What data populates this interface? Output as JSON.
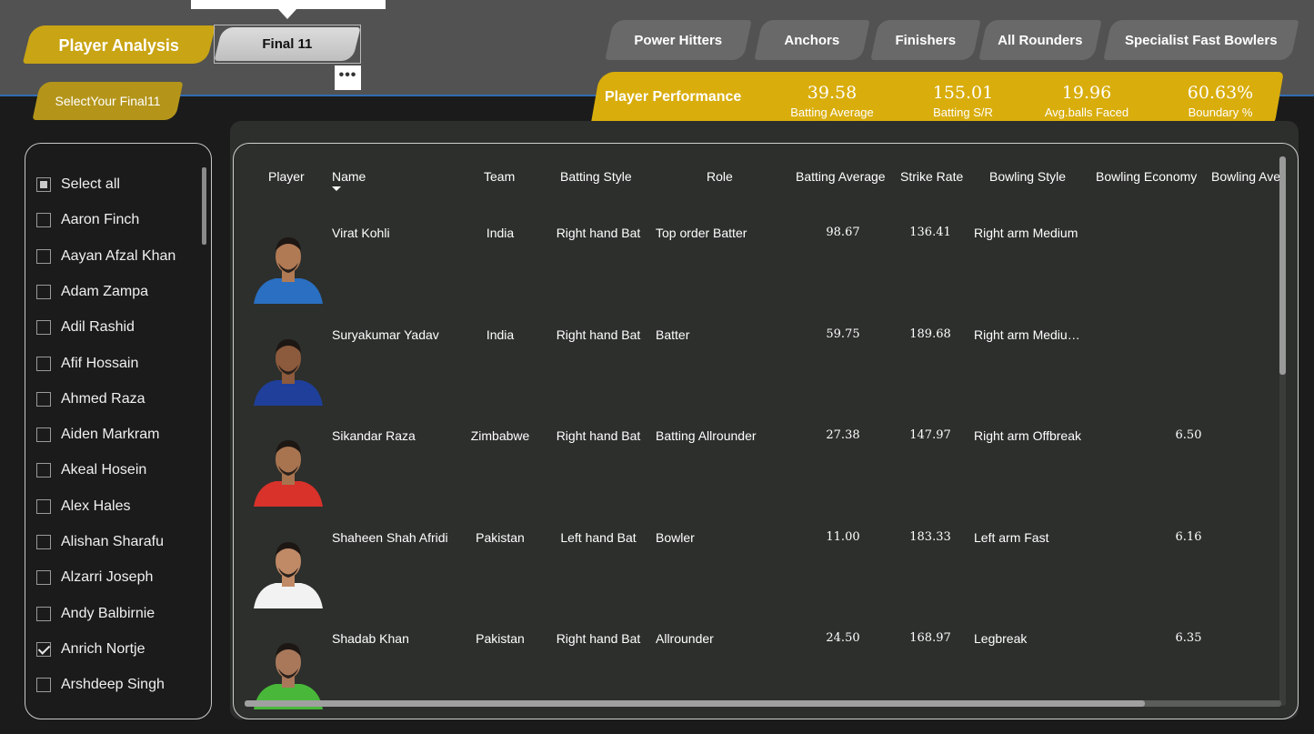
{
  "header": {
    "tabs": {
      "player_analysis": "Player Analysis",
      "final11": "Final 11",
      "more": "•••"
    },
    "select_final11": "SelectYour Final11",
    "nav": [
      "Power Hitters",
      "Anchors",
      "Finishers",
      "All Rounders",
      "Specialist Fast Bowlers"
    ]
  },
  "kpi": {
    "title": "Player Performance",
    "items": [
      {
        "value": "39.58",
        "label": "Batting Average"
      },
      {
        "value": "155.01",
        "label": "Batting S/R"
      },
      {
        "value": "19.96",
        "label": "Avg.balls Faced"
      },
      {
        "value": "60.63%",
        "label": "Boundary %"
      }
    ]
  },
  "slicer": {
    "items": [
      {
        "label": "Select all",
        "state": "partial"
      },
      {
        "label": "Aaron Finch",
        "state": "unchecked"
      },
      {
        "label": "Aayan Afzal Khan",
        "state": "unchecked"
      },
      {
        "label": "Adam Zampa",
        "state": "unchecked"
      },
      {
        "label": "Adil Rashid",
        "state": "unchecked"
      },
      {
        "label": "Afif Hossain",
        "state": "unchecked"
      },
      {
        "label": "Ahmed Raza",
        "state": "unchecked"
      },
      {
        "label": "Aiden Markram",
        "state": "unchecked"
      },
      {
        "label": "Akeal Hosein",
        "state": "unchecked"
      },
      {
        "label": "Alex Hales",
        "state": "unchecked"
      },
      {
        "label": "Alishan Sharafu",
        "state": "unchecked"
      },
      {
        "label": "Alzarri Joseph",
        "state": "unchecked"
      },
      {
        "label": "Andy Balbirnie",
        "state": "unchecked"
      },
      {
        "label": "Anrich Nortje",
        "state": "checked"
      },
      {
        "label": "Arshdeep Singh",
        "state": "unchecked"
      }
    ]
  },
  "table": {
    "columns": [
      "Player",
      "Name",
      "Team",
      "Batting Style",
      "Role",
      "Batting Average",
      "Strike Rate",
      "Bowling Style",
      "Bowling Economy",
      "Bowling Ave"
    ],
    "rows": [
      {
        "name": "Virat Kohli",
        "team": "India",
        "batting_style": "Right hand Bat",
        "role": "Top order Batter",
        "batting_avg": "98.67",
        "strike_rate": "136.41",
        "bowling_style": "Right arm Medium",
        "bowling_economy": "",
        "jersey": "#2a6fc1",
        "skin": "#b07a55"
      },
      {
        "name": "Suryakumar Yadav",
        "team": "India",
        "batting_style": "Right hand Bat",
        "role": "Batter",
        "batting_avg": "59.75",
        "strike_rate": "189.68",
        "bowling_style": "Right arm Mediu…",
        "bowling_economy": "",
        "jersey": "#1f3f9a",
        "skin": "#8c5a3c"
      },
      {
        "name": "Sikandar Raza",
        "team": "Zimbabwe",
        "batting_style": "Right hand Bat",
        "role": "Batting Allrounder",
        "batting_avg": "27.38",
        "strike_rate": "147.97",
        "bowling_style": "Right arm Offbreak",
        "bowling_economy": "6.50",
        "jersey": "#d8322a",
        "skin": "#a8744f"
      },
      {
        "name": "Shaheen Shah Afridi",
        "team": "Pakistan",
        "batting_style": "Left hand Bat",
        "role": "Bowler",
        "batting_avg": "11.00",
        "strike_rate": "183.33",
        "bowling_style": "Left arm Fast",
        "bowling_economy": "6.16",
        "jersey": "#f2f2f2",
        "skin": "#c08a66"
      },
      {
        "name": "Shadab Khan",
        "team": "Pakistan",
        "batting_style": "Right hand Bat",
        "role": "Allrounder",
        "batting_avg": "24.50",
        "strike_rate": "168.97",
        "bowling_style": "Legbreak",
        "bowling_economy": "6.35",
        "jersey": "#49b83a",
        "skin": "#a9785a"
      }
    ]
  },
  "colors": {
    "accent_gold": "#d9ad0b",
    "tab_gold": "#c9a414",
    "header_bg": "#525252",
    "panel_bg": "#2c2f2c"
  }
}
